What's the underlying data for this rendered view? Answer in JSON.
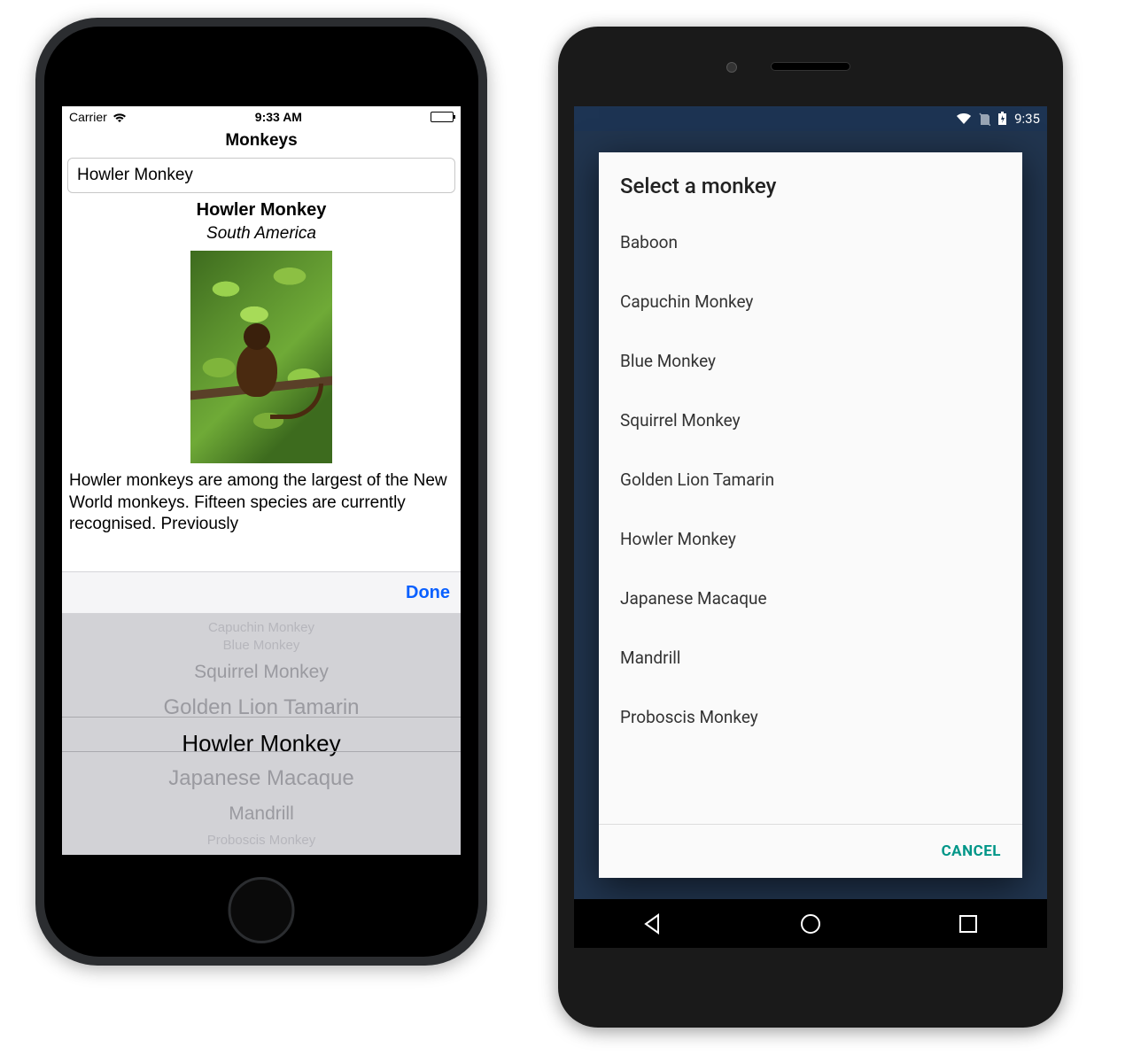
{
  "ios": {
    "statusbar": {
      "carrier": "Carrier",
      "time": "9:33 AM"
    },
    "page_title": "Monkeys",
    "selected_value": "Howler Monkey",
    "detail": {
      "name": "Howler Monkey",
      "region": "South America",
      "description": "Howler monkeys are among the largest of the New World monkeys. Fifteen species are currently recognised. Previously"
    },
    "picker": {
      "done_label": "Done",
      "items": [
        "Capuchin Monkey",
        "Blue Monkey",
        "Squirrel Monkey",
        "Golden Lion Tamarin",
        "Howler Monkey",
        "Japanese Macaque",
        "Mandrill",
        "Proboscis Monkey"
      ],
      "item_0": "Capuchin Monkey",
      "item_1": "Blue Monkey",
      "item_2": "Squirrel Monkey",
      "item_3": "Golden Lion Tamarin",
      "item_4": "Howler Monkey",
      "item_5": "Japanese Macaque",
      "item_6": "Mandrill",
      "item_7": "Proboscis Monkey",
      "selected_index": 4
    }
  },
  "android": {
    "statusbar": {
      "time": "9:35"
    },
    "dialog": {
      "title": "Select a monkey",
      "items": [
        "Baboon",
        "Capuchin Monkey",
        "Blue Monkey",
        "Squirrel Monkey",
        "Golden Lion Tamarin",
        "Howler Monkey",
        "Japanese Macaque",
        "Mandrill",
        "Proboscis Monkey"
      ],
      "item_0": "Baboon",
      "item_1": "Capuchin Monkey",
      "item_2": "Blue Monkey",
      "item_3": "Squirrel Monkey",
      "item_4": "Golden Lion Tamarin",
      "item_5": "Howler Monkey",
      "item_6": "Japanese Macaque",
      "item_7": "Mandrill",
      "item_8": "Proboscis Monkey",
      "cancel_label": "CANCEL"
    }
  }
}
